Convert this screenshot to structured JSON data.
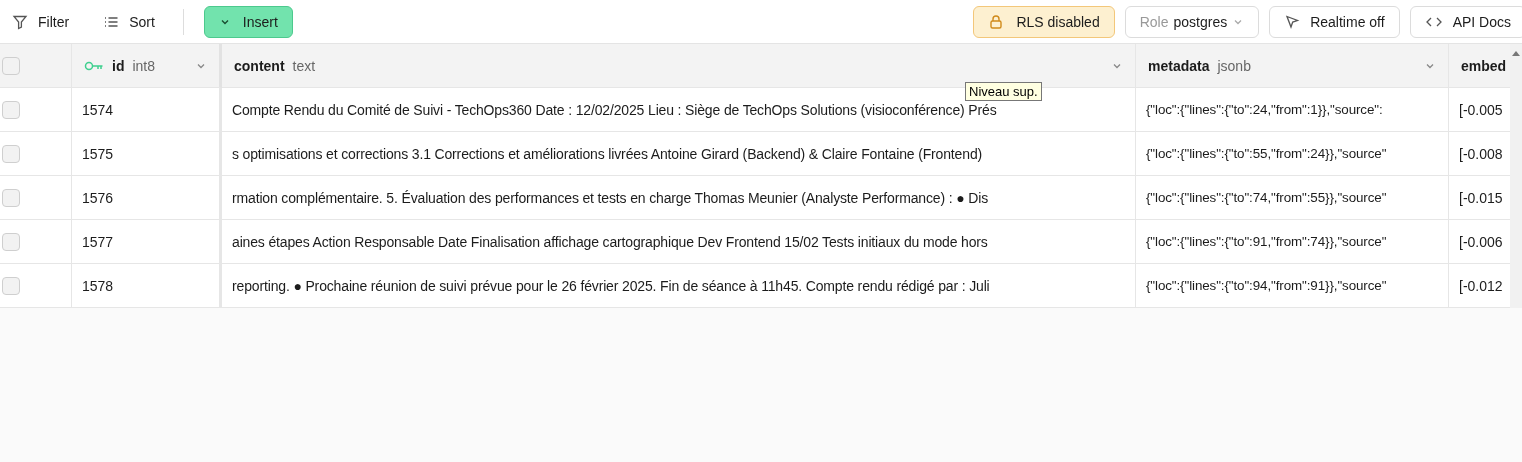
{
  "toolbar": {
    "left": [
      {
        "kind": "filter",
        "label": "Filter"
      },
      {
        "kind": "sort",
        "label": "Sort"
      },
      {
        "kind": "insert",
        "label": "Insert"
      }
    ],
    "right": [
      {
        "kind": "rls",
        "label": "RLS disabled"
      },
      {
        "kind": "role",
        "prefix": "Role",
        "label": "postgres"
      },
      {
        "kind": "realtime",
        "label": "Realtime off"
      },
      {
        "kind": "docs",
        "label": "API Docs"
      }
    ]
  },
  "table": {
    "select_all": {
      "checked": false
    },
    "columns": [
      {
        "name": "id",
        "type": "int8",
        "primary_key": true
      },
      {
        "name": "content",
        "type": "text",
        "primary_key": false
      },
      {
        "name": "metadata",
        "type": "jsonb",
        "primary_key": false
      },
      {
        "name": "embed",
        "primary_key": false
      }
    ],
    "rows": [
      {
        "selected": false,
        "cells": [
          "1574",
          "Compte Rendu du Comité de Suivi - TechOps360 Date : 12/02/2025 Lieu : Siège de TechOps Solutions (visioconférence) Prés",
          "{\"loc\":{\"lines\":{\"to\":24,\"from\":1}},\"source\":",
          "[-0.005"
        ]
      },
      {
        "selected": false,
        "cells": [
          "1575",
          "s optimisations et corrections 3.1 Corrections et améliorations livrées Antoine Girard (Backend) & Claire Fontaine (Frontend)",
          "{\"loc\":{\"lines\":{\"to\":55,\"from\":24}},\"source\"",
          "[-0.008"
        ]
      },
      {
        "selected": false,
        "cells": [
          "1576",
          "rmation complémentaire. 5. Évaluation des performances et tests en charge Thomas Meunier (Analyste Performance) : ● Dis",
          "{\"loc\":{\"lines\":{\"to\":74,\"from\":55}},\"source\"",
          "[-0.015"
        ]
      },
      {
        "selected": false,
        "cells": [
          "1577",
          "aines étapes Action Responsable Date Finalisation affichage cartographique Dev Frontend 15/02 Tests initiaux du mode hors",
          "{\"loc\":{\"lines\":{\"to\":91,\"from\":74}},\"source\"",
          "[-0.006"
        ]
      },
      {
        "selected": false,
        "cells": [
          "1578",
          "reporting. ● Prochaine réunion de suivi prévue pour le 26 février 2025. Fin de séance à 11h45. Compte rendu rédigé par : Juli",
          "{\"loc\":{\"lines\":{\"to\":94,\"from\":91}},\"source\"",
          "[-0.012"
        ]
      }
    ]
  },
  "tooltip": {
    "text": "Niveau sup."
  }
}
